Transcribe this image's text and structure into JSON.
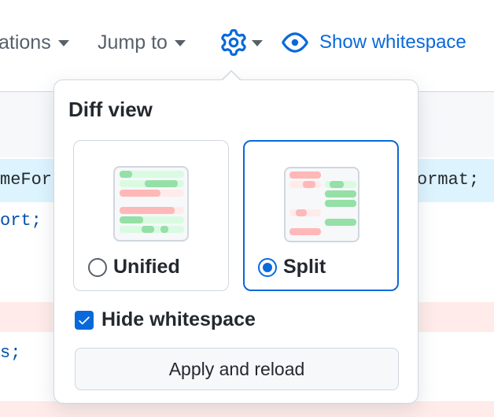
{
  "toolbar": {
    "conversations_label": "ations",
    "jump_to_label": "Jump to",
    "settings_icon": "gear-icon",
    "show_whitespace_label": "Show whitespace",
    "show_whitespace_icon": "eye-icon"
  },
  "code": {
    "line1_left": "meFor",
    "line1_right": "ormat;",
    "line2": "ort;",
    "line3": "s;"
  },
  "diff_view": {
    "title": "Diff view",
    "options": [
      {
        "label": "Unified",
        "selected": false
      },
      {
        "label": "Split",
        "selected": true
      }
    ],
    "hide_whitespace_label": "Hide whitespace",
    "hide_whitespace_checked": true,
    "apply_label": "Apply and reload"
  },
  "colors": {
    "accent": "#0969da",
    "border": "#d0d7de",
    "added": "#aceebb",
    "removed": "#ffcecb",
    "added_strong": "#6fdd8b",
    "removed_strong": "#ff818266"
  }
}
